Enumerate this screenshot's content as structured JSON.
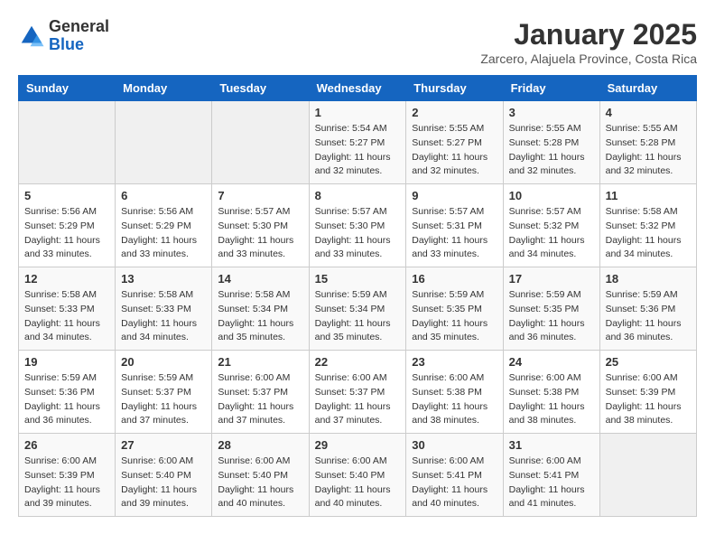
{
  "header": {
    "logo": {
      "line1": "General",
      "line2": "Blue"
    },
    "title": "January 2025",
    "subtitle": "Zarcero, Alajuela Province, Costa Rica"
  },
  "weekdays": [
    "Sunday",
    "Monday",
    "Tuesday",
    "Wednesday",
    "Thursday",
    "Friday",
    "Saturday"
  ],
  "weeks": [
    [
      {
        "day": "",
        "info": ""
      },
      {
        "day": "",
        "info": ""
      },
      {
        "day": "",
        "info": ""
      },
      {
        "day": "1",
        "info": "Sunrise: 5:54 AM\nSunset: 5:27 PM\nDaylight: 11 hours\nand 32 minutes."
      },
      {
        "day": "2",
        "info": "Sunrise: 5:55 AM\nSunset: 5:27 PM\nDaylight: 11 hours\nand 32 minutes."
      },
      {
        "day": "3",
        "info": "Sunrise: 5:55 AM\nSunset: 5:28 PM\nDaylight: 11 hours\nand 32 minutes."
      },
      {
        "day": "4",
        "info": "Sunrise: 5:55 AM\nSunset: 5:28 PM\nDaylight: 11 hours\nand 32 minutes."
      }
    ],
    [
      {
        "day": "5",
        "info": "Sunrise: 5:56 AM\nSunset: 5:29 PM\nDaylight: 11 hours\nand 33 minutes."
      },
      {
        "day": "6",
        "info": "Sunrise: 5:56 AM\nSunset: 5:29 PM\nDaylight: 11 hours\nand 33 minutes."
      },
      {
        "day": "7",
        "info": "Sunrise: 5:57 AM\nSunset: 5:30 PM\nDaylight: 11 hours\nand 33 minutes."
      },
      {
        "day": "8",
        "info": "Sunrise: 5:57 AM\nSunset: 5:30 PM\nDaylight: 11 hours\nand 33 minutes."
      },
      {
        "day": "9",
        "info": "Sunrise: 5:57 AM\nSunset: 5:31 PM\nDaylight: 11 hours\nand 33 minutes."
      },
      {
        "day": "10",
        "info": "Sunrise: 5:57 AM\nSunset: 5:32 PM\nDaylight: 11 hours\nand 34 minutes."
      },
      {
        "day": "11",
        "info": "Sunrise: 5:58 AM\nSunset: 5:32 PM\nDaylight: 11 hours\nand 34 minutes."
      }
    ],
    [
      {
        "day": "12",
        "info": "Sunrise: 5:58 AM\nSunset: 5:33 PM\nDaylight: 11 hours\nand 34 minutes."
      },
      {
        "day": "13",
        "info": "Sunrise: 5:58 AM\nSunset: 5:33 PM\nDaylight: 11 hours\nand 34 minutes."
      },
      {
        "day": "14",
        "info": "Sunrise: 5:58 AM\nSunset: 5:34 PM\nDaylight: 11 hours\nand 35 minutes."
      },
      {
        "day": "15",
        "info": "Sunrise: 5:59 AM\nSunset: 5:34 PM\nDaylight: 11 hours\nand 35 minutes."
      },
      {
        "day": "16",
        "info": "Sunrise: 5:59 AM\nSunset: 5:35 PM\nDaylight: 11 hours\nand 35 minutes."
      },
      {
        "day": "17",
        "info": "Sunrise: 5:59 AM\nSunset: 5:35 PM\nDaylight: 11 hours\nand 36 minutes."
      },
      {
        "day": "18",
        "info": "Sunrise: 5:59 AM\nSunset: 5:36 PM\nDaylight: 11 hours\nand 36 minutes."
      }
    ],
    [
      {
        "day": "19",
        "info": "Sunrise: 5:59 AM\nSunset: 5:36 PM\nDaylight: 11 hours\nand 36 minutes."
      },
      {
        "day": "20",
        "info": "Sunrise: 5:59 AM\nSunset: 5:37 PM\nDaylight: 11 hours\nand 37 minutes."
      },
      {
        "day": "21",
        "info": "Sunrise: 6:00 AM\nSunset: 5:37 PM\nDaylight: 11 hours\nand 37 minutes."
      },
      {
        "day": "22",
        "info": "Sunrise: 6:00 AM\nSunset: 5:37 PM\nDaylight: 11 hours\nand 37 minutes."
      },
      {
        "day": "23",
        "info": "Sunrise: 6:00 AM\nSunset: 5:38 PM\nDaylight: 11 hours\nand 38 minutes."
      },
      {
        "day": "24",
        "info": "Sunrise: 6:00 AM\nSunset: 5:38 PM\nDaylight: 11 hours\nand 38 minutes."
      },
      {
        "day": "25",
        "info": "Sunrise: 6:00 AM\nSunset: 5:39 PM\nDaylight: 11 hours\nand 38 minutes."
      }
    ],
    [
      {
        "day": "26",
        "info": "Sunrise: 6:00 AM\nSunset: 5:39 PM\nDaylight: 11 hours\nand 39 minutes."
      },
      {
        "day": "27",
        "info": "Sunrise: 6:00 AM\nSunset: 5:40 PM\nDaylight: 11 hours\nand 39 minutes."
      },
      {
        "day": "28",
        "info": "Sunrise: 6:00 AM\nSunset: 5:40 PM\nDaylight: 11 hours\nand 40 minutes."
      },
      {
        "day": "29",
        "info": "Sunrise: 6:00 AM\nSunset: 5:40 PM\nDaylight: 11 hours\nand 40 minutes."
      },
      {
        "day": "30",
        "info": "Sunrise: 6:00 AM\nSunset: 5:41 PM\nDaylight: 11 hours\nand 40 minutes."
      },
      {
        "day": "31",
        "info": "Sunrise: 6:00 AM\nSunset: 5:41 PM\nDaylight: 11 hours\nand 41 minutes."
      },
      {
        "day": "",
        "info": ""
      }
    ]
  ]
}
